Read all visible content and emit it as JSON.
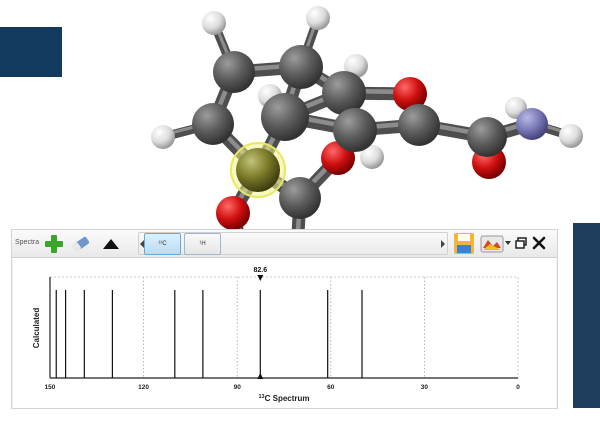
{
  "toolbar": {
    "spectra_label": "Spectra",
    "tab_13c_label": "¹³C",
    "tab_1h_label": "¹H",
    "icons": [
      "add-icon",
      "eraser-icon",
      "triangle-up-icon",
      "scroll-left-icon",
      "scroll-right-icon",
      "save-icon",
      "color-scheme-icon",
      "dropdown-icon",
      "restore-window-icon",
      "close-icon"
    ]
  },
  "colors": {
    "navy": "#123a5e",
    "carbon": "#5a5a5a",
    "oxygen": "#d01010",
    "nitrogen": "#7a7ab8",
    "hydrogen": "#e6e6e6",
    "sulfur": "#7a7a28",
    "highlight": "#f0f08a"
  },
  "chart_data": {
    "type": "bar",
    "title": "",
    "xlabel": "13C Spectrum",
    "ylabel": "Calculated",
    "xlim": [
      150,
      0
    ],
    "ylim": [
      0,
      1
    ],
    "xticks": [
      "150",
      "120",
      "90",
      "60",
      "30",
      "0"
    ],
    "xtick_values": [
      150,
      120,
      90,
      60,
      30,
      0
    ],
    "x": [
      148,
      145,
      139,
      130,
      110,
      101,
      82.6,
      61,
      50
    ],
    "values": [
      1,
      1,
      1,
      1,
      1,
      1,
      1,
      1,
      1
    ],
    "selected_peak": {
      "x": 82.6,
      "label": "82.6"
    },
    "grid": "dotted vertical at ticks"
  }
}
